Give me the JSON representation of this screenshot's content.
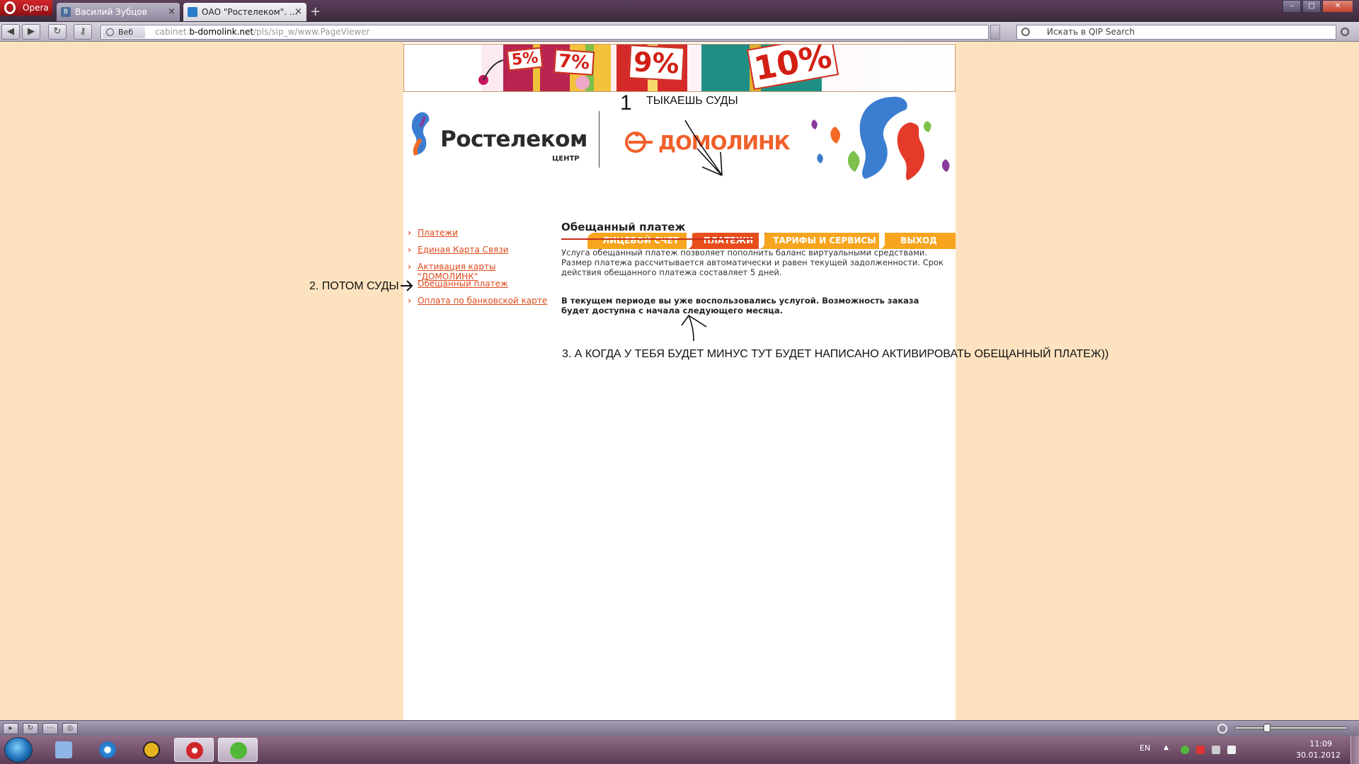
{
  "browser": {
    "app_button": "Opera",
    "tabs": [
      {
        "label": "Василий Зубцов",
        "favicon": "В"
      },
      {
        "label": "ОАО \"Ростелеком\". ...",
        "favicon": "?"
      }
    ],
    "address_badge": "Веб",
    "url_prefix": "cabinet.",
    "url_domain": "b-domolink.net",
    "url_path": "/pls/sip_w/www.PageViewer",
    "search_placeholder": "Искать в QIP Search"
  },
  "promo": {
    "tags": [
      "5%",
      "7%",
      "9%",
      "10%"
    ]
  },
  "header": {
    "brand": "Ростелеком",
    "brand_sub": "ЦЕНТР",
    "partner_brand": "ДОМОЛИНК"
  },
  "nav": {
    "account": "ЛИЦЕВОЙ СЧЕТ",
    "payments": "ПЛАТЕЖИ",
    "tariffs": "ТАРИФЫ И СЕРВИСЫ",
    "exit": "ВЫХОД"
  },
  "left_menu": [
    {
      "label": "Платежи"
    },
    {
      "label": "Единая Карта Связи"
    },
    {
      "label": "Активация карты \"ДОМОЛИНК\""
    },
    {
      "label": "Обещанный платеж"
    },
    {
      "label": "Оплата по банковской карте"
    }
  ],
  "content": {
    "title": "Обещанный платеж",
    "description": "Услуга обещанный платеж позволяет пополнить баланс виртуальными средствами. Размер платежа рассчитывается автоматически и равен текущей задолженности. Срок действия обещанного платежа составляет 5 дней.",
    "notice": "В текущем периоде вы уже воспользовались услугой. Возможность заказа будет доступна с начала следующего месяца."
  },
  "annotations": {
    "num1": "1",
    "step1": "ТЫКАЕШЬ СУДЫ",
    "step2": "2. ПОТОМ СУДЫ",
    "step3": "3. А КОГДА У ТЕБЯ БУДЕТ МИНУС ТУТ БУДЕТ НАПИСАНО АКТИВИРОВАТЬ ОБЕЩАННЫЙ ПЛАТЕЖ))"
  },
  "taskbar": {
    "lang": "EN",
    "time": "11:09",
    "date": "30.01.2012"
  },
  "colors": {
    "page_background": "#fde2bf",
    "accent_orange": "#f7a51e",
    "accent_red": "#e84e1b",
    "link": "#e04a1c"
  }
}
